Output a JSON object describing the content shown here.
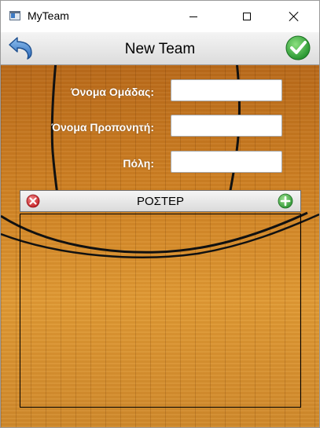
{
  "window": {
    "title": "MyTeam",
    "icon": "app-window-icon",
    "controls": [
      "minimize-icon",
      "maximize-icon",
      "close-icon"
    ]
  },
  "navbar": {
    "title": "New Team",
    "back_icon": "back-arrow-icon",
    "confirm_icon": "checkmark-icon",
    "colors": {
      "confirm": "#2fa43a",
      "back": "#3a78c8"
    }
  },
  "form": {
    "team_name_label": "Όνομα Ομάδας:",
    "team_name_value": "",
    "coach_name_label": "Όνομα Προπονητή:",
    "coach_name_value": "",
    "city_label": "Πόλη:",
    "city_value": ""
  },
  "roster": {
    "title": "ΡΟΣΤΕΡ",
    "remove_icon": "remove-red-x-icon",
    "add_icon": "add-green-plus-icon",
    "players": [],
    "colors": {
      "remove": "#d9363a",
      "add": "#3aa63a"
    }
  },
  "background": {
    "description_color": "#cf8224"
  }
}
